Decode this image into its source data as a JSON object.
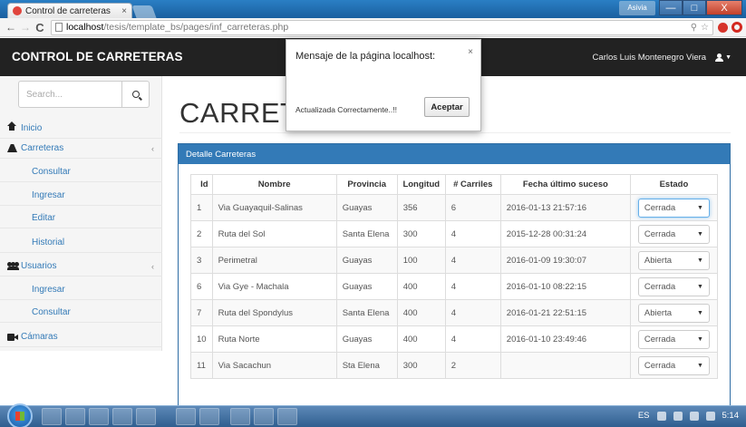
{
  "browser": {
    "tab_title": "Control de carreteras",
    "tab_close": "×",
    "url_host": "localhost",
    "url_path": "/tesis/template_bs/pages/inf_carreteras.php",
    "win_user": "Asivia",
    "win_min": "—",
    "win_max": "□",
    "win_close": "X"
  },
  "navbar": {
    "brand": "CONTROL DE CARRETERAS",
    "user_name": "Carlos Luis Montenegro Viera"
  },
  "sidebar": {
    "search_placeholder": "Search...",
    "items": [
      {
        "label": "Inicio"
      },
      {
        "label": "Carreteras"
      },
      {
        "label": "Consultar"
      },
      {
        "label": "Ingresar"
      },
      {
        "label": "Editar"
      },
      {
        "label": "Historial"
      },
      {
        "label": "Usuarios"
      },
      {
        "label": "Ingresar"
      },
      {
        "label": "Consultar"
      },
      {
        "label": "Cámaras"
      }
    ]
  },
  "main": {
    "page_title": "CARRETERAS",
    "panel_title": "Detalle Carreteras",
    "columns": [
      "Id",
      "Nombre",
      "Provincia",
      "Longitud",
      "# Carriles",
      "Fecha último suceso",
      "Estado"
    ],
    "rows": [
      {
        "id": "1",
        "nombre": "Via Guayaquil-Salinas",
        "provincia": "Guayas",
        "longitud": "356",
        "carriles": "6",
        "fecha": "2016-01-13 21:57:16",
        "estado": "Cerrada"
      },
      {
        "id": "2",
        "nombre": "Ruta del Sol",
        "provincia": "Santa Elena",
        "longitud": "300",
        "carriles": "4",
        "fecha": "2015-12-28 00:31:24",
        "estado": "Cerrada"
      },
      {
        "id": "3",
        "nombre": "Perimetral",
        "provincia": "Guayas",
        "longitud": "100",
        "carriles": "4",
        "fecha": "2016-01-09 19:30:07",
        "estado": "Abierta"
      },
      {
        "id": "6",
        "nombre": "Via Gye - Machala",
        "provincia": "Guayas",
        "longitud": "400",
        "carriles": "4",
        "fecha": "2016-01-10 08:22:15",
        "estado": "Cerrada"
      },
      {
        "id": "7",
        "nombre": "Ruta del Spondylus",
        "provincia": "Santa Elena",
        "longitud": "400",
        "carriles": "4",
        "fecha": "2016-01-21 22:51:15",
        "estado": "Abierta"
      },
      {
        "id": "10",
        "nombre": "Ruta Norte",
        "provincia": "Guayas",
        "longitud": "400",
        "carriles": "4",
        "fecha": "2016-01-10 23:49:46",
        "estado": "Cerrada"
      },
      {
        "id": "11",
        "nombre": "Via Sacachun",
        "provincia": "Sta Elena",
        "longitud": "300",
        "carriles": "2",
        "fecha": "",
        "estado": "Cerrada"
      }
    ]
  },
  "dialog": {
    "title": "Mensaje de la página localhost:",
    "close": "×",
    "message": "Actualizada Correctamente..!!",
    "button": "Aceptar"
  },
  "taskbar": {
    "lang": "ES",
    "clock": "5:14"
  }
}
